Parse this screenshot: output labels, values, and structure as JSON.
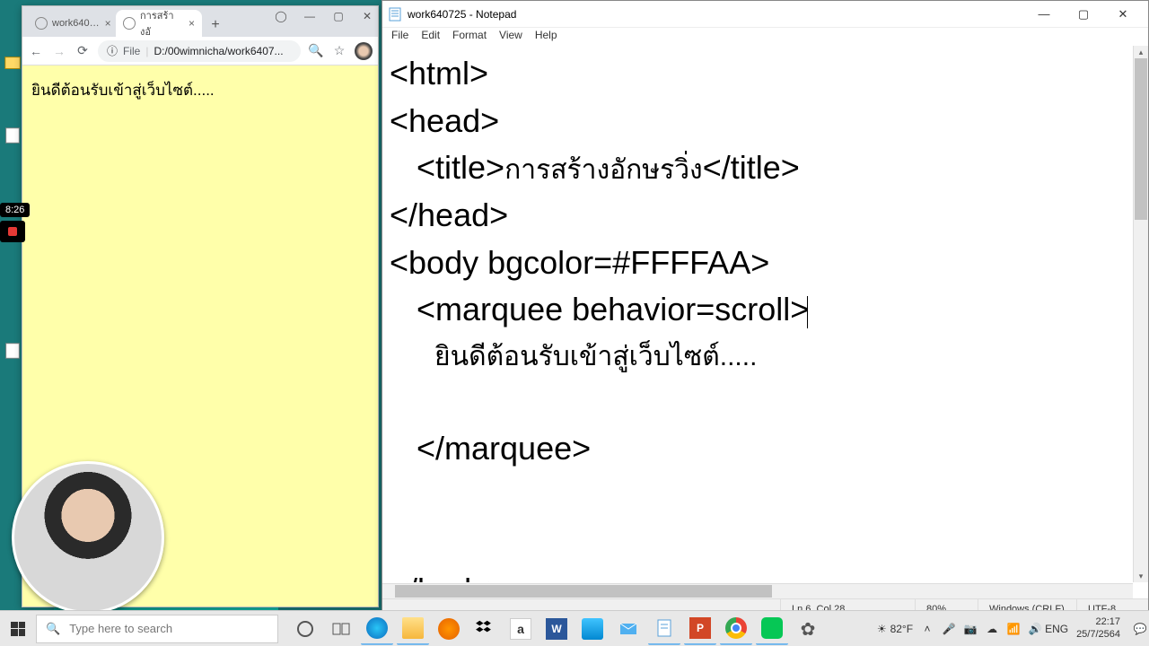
{
  "chrome": {
    "tabs": [
      {
        "label": "work640…",
        "active": false
      },
      {
        "label": "การสร้างอั",
        "active": true
      }
    ],
    "url_proto": "File",
    "url_pipe": "|",
    "url_path": "D:/00wimnicha/work6407...",
    "info_glyph": "ⓘ"
  },
  "page": {
    "marquee_text": "ยินดีต้อนรับเข้าสู่เว็บไซต์....."
  },
  "notepad": {
    "title": "work640725 - Notepad",
    "menu": [
      "File",
      "Edit",
      "Format",
      "View",
      "Help"
    ],
    "code": {
      "l1": "<html>",
      "l2": "<head>",
      "l3a": "   <title>",
      "l3b": "การสร้างอักษรวิ่ง",
      "l3c": "</title>",
      "l4": "</head>",
      "l5": "<body bgcolor=#FFFFAA>",
      "l6": "   <marquee behavior=scroll>",
      "l7": "      ยินดีต้อนรับเข้าสู่เว็บไซต์.....",
      "l8": "",
      "l9": "   </marquee>",
      "l10": "",
      "l11": "",
      "l12": "</body>"
    },
    "status": {
      "pos": "Ln 6, Col 28",
      "zoom": "80%",
      "eol": "Windows (CRLF)",
      "enc": "UTF-8"
    }
  },
  "rec": {
    "time": "8:26"
  },
  "taskbar": {
    "search_placeholder": "Type here to search",
    "weather": "82°F",
    "lang": "ENG",
    "time": "22:17",
    "date": "25/7/2564"
  }
}
